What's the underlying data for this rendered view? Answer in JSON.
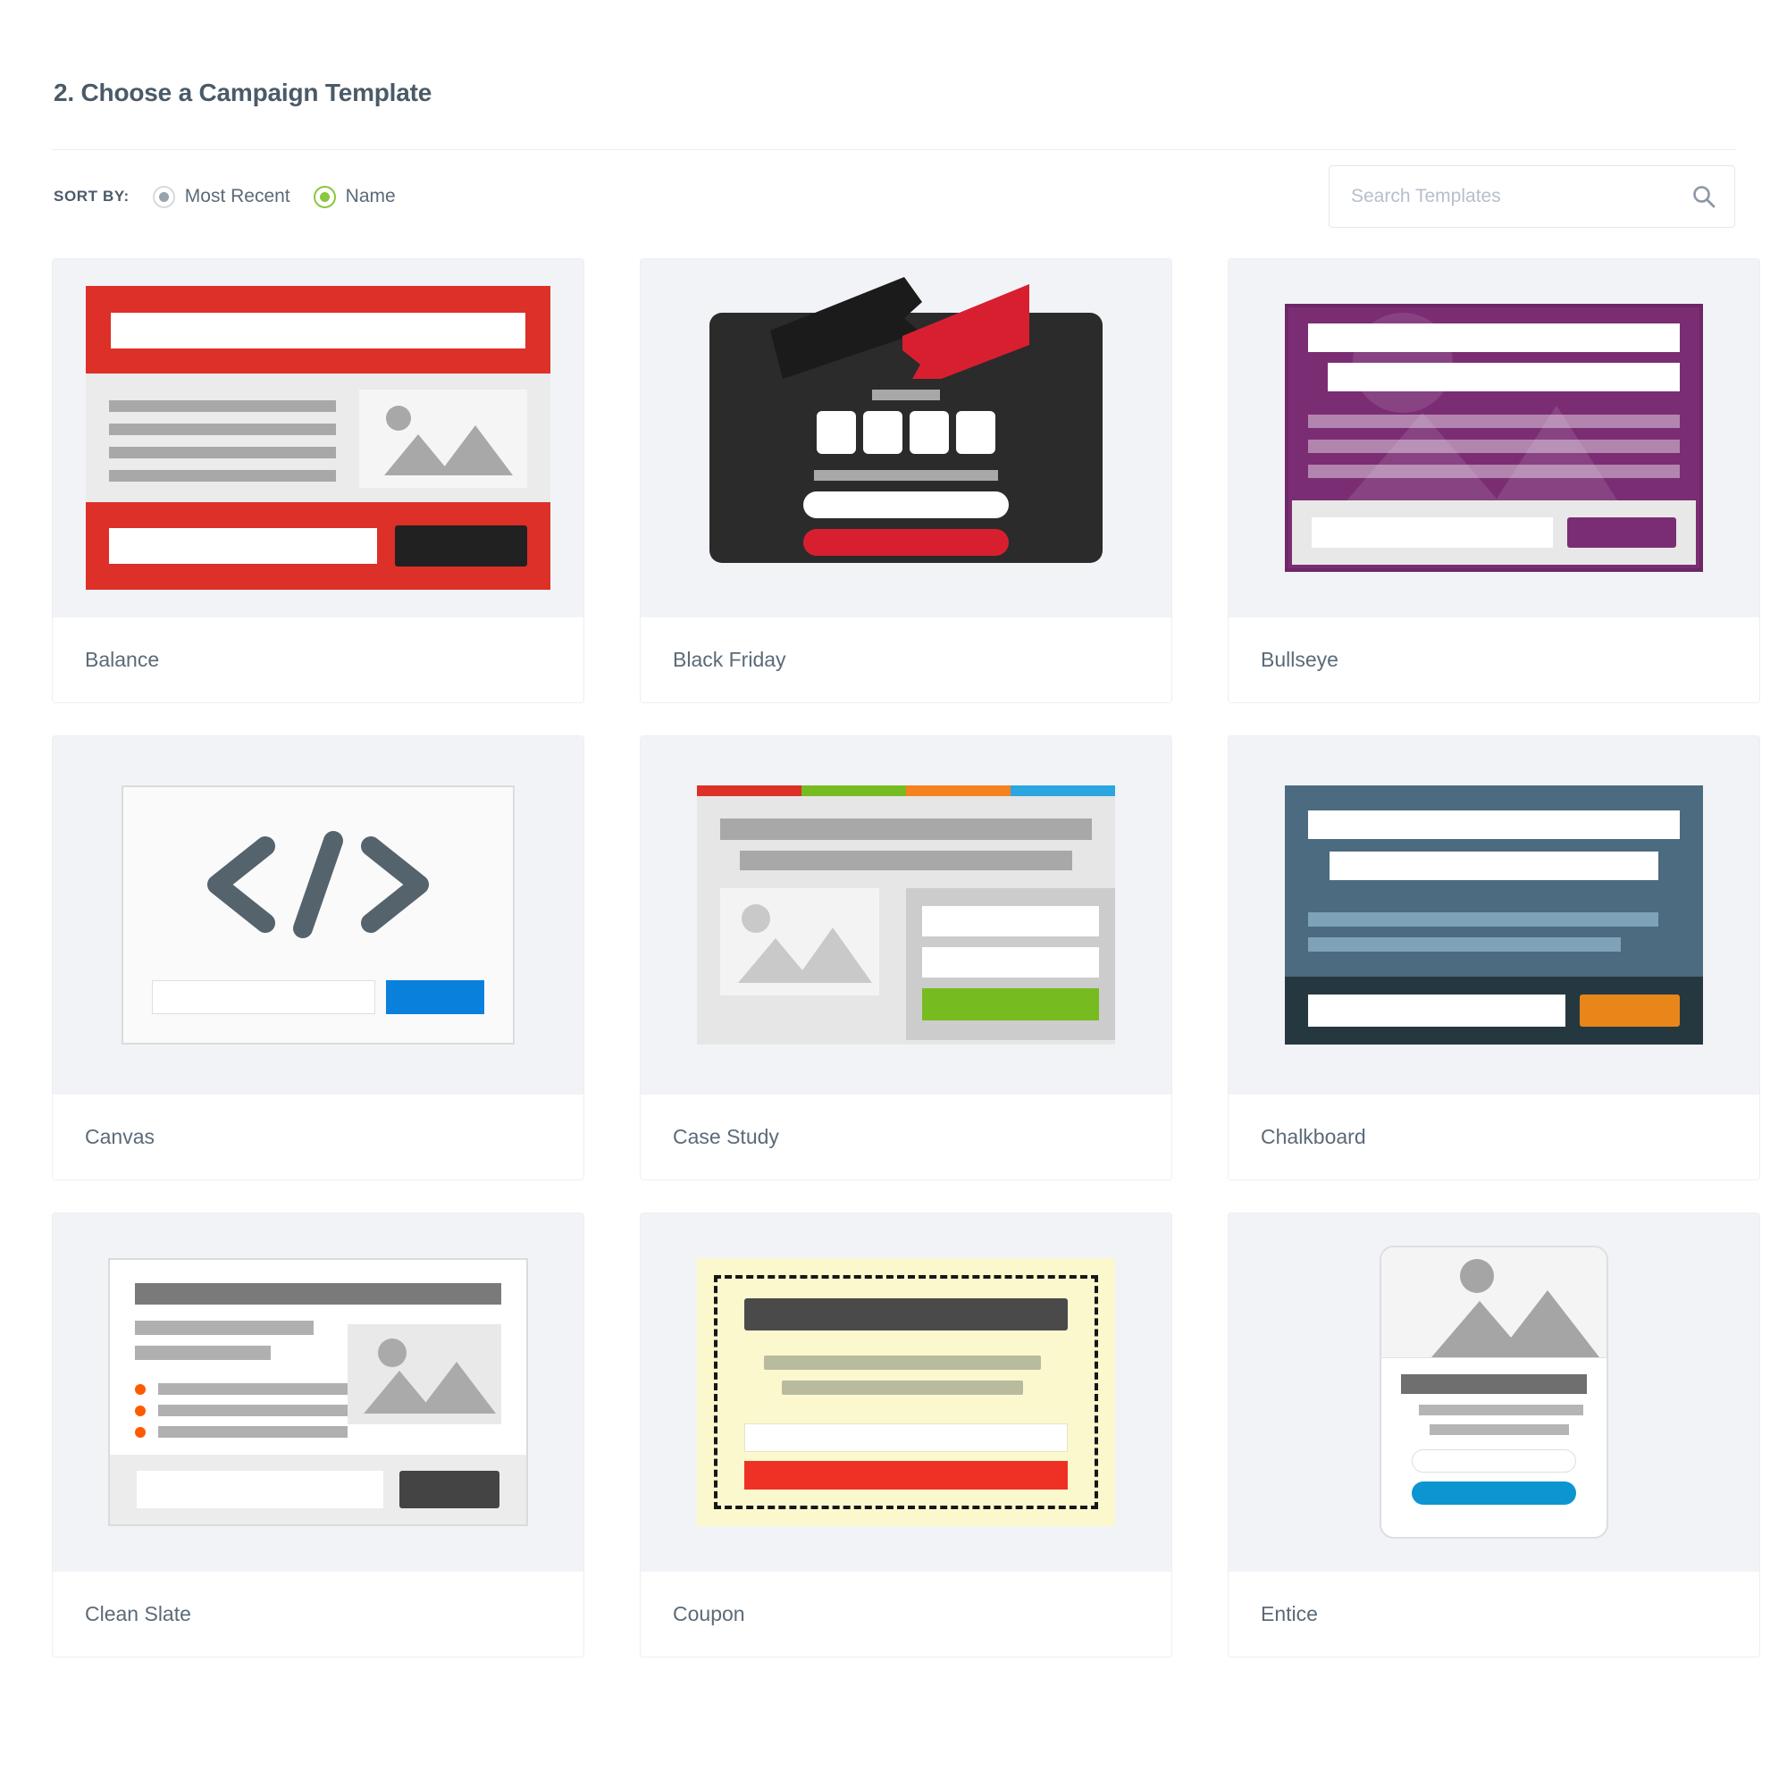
{
  "header": {
    "title": "2. Choose a Campaign Template"
  },
  "controls": {
    "sort_label": "SORT BY:",
    "sort_options": [
      {
        "label": "Most Recent",
        "selected": false
      },
      {
        "label": "Name",
        "selected": true
      }
    ],
    "search": {
      "placeholder": "Search Templates",
      "value": "",
      "icon": "search-icon"
    }
  },
  "colors": {
    "accent_green": "#8cc63e",
    "page_text": "#5b6a78",
    "thumb_bg": "#f1f3f7",
    "card_border": "#eceef1"
  },
  "templates": [
    {
      "name": "Balance",
      "thumb": "balance-thumbnail",
      "palette": [
        "#dc3028",
        "#ebebeb",
        "#212121"
      ]
    },
    {
      "name": "Black Friday",
      "thumb": "black-friday-thumbnail",
      "palette": [
        "#2b2b2b",
        "#d81f30",
        "#ffffff"
      ]
    },
    {
      "name": "Bullseye",
      "thumb": "bullseye-thumbnail",
      "palette": [
        "#7b2d74",
        "#e8e8e8",
        "#ffffff"
      ]
    },
    {
      "name": "Canvas",
      "thumb": "canvas-thumbnail",
      "palette": [
        "#fafafa",
        "#55636d",
        "#0a80dd"
      ]
    },
    {
      "name": "Case Study",
      "thumb": "case-study-thumbnail",
      "palette": [
        "#dc3028",
        "#76bc21",
        "#f58220",
        "#2ba6e0"
      ]
    },
    {
      "name": "Chalkboard",
      "thumb": "chalkboard-thumbnail",
      "palette": [
        "#4c6b80",
        "#26383f",
        "#e8861a"
      ]
    },
    {
      "name": "Clean Slate",
      "thumb": "clean-slate-thumbnail",
      "palette": [
        "#ffffff",
        "#ff5a00",
        "#444444"
      ]
    },
    {
      "name": "Coupon",
      "thumb": "coupon-thumbnail",
      "palette": [
        "#fbf8cd",
        "#171717",
        "#ee3124"
      ]
    },
    {
      "name": "Entice",
      "thumb": "entice-thumbnail",
      "palette": [
        "#ffffff",
        "#6f6f6f",
        "#0c95d1"
      ]
    }
  ]
}
